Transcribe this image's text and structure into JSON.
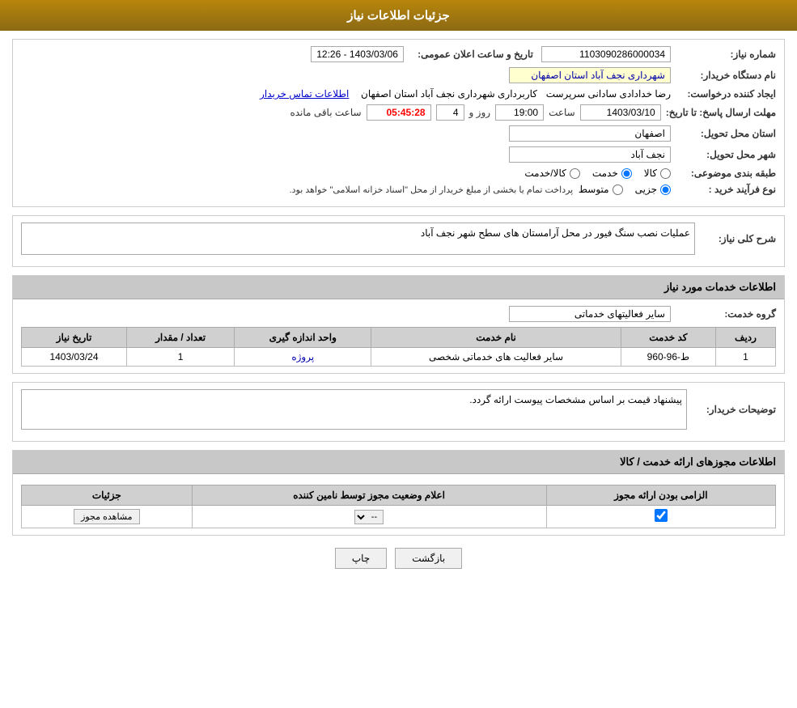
{
  "page": {
    "title": "جزئیات اطلاعات نیاز"
  },
  "header": {
    "title": "جزئیات اطلاعات نیاز"
  },
  "need_info": {
    "need_number_label": "شماره نیاز:",
    "need_number_value": "1103090286000034",
    "announcement_label": "تاریخ و ساعت اعلان عمومی:",
    "announcement_value": "1403/03/06 - 12:26",
    "buyer_org_label": "نام دستگاه خریدار:",
    "buyer_org_value": "شهرداری نجف آباد استان اصفهان",
    "creator_label": "ایجاد کننده درخواست:",
    "creator_name": "رضا خدادادی سادانی سرپرست",
    "creator_role": "کاربرداری شهرداری نجف آباد استان اصفهان",
    "creator_contact": "اطلاعات تماس خریدار",
    "deadline_label": "مهلت ارسال پاسخ: تا تاریخ:",
    "deadline_date": "1403/03/10",
    "deadline_time_label": "ساعت",
    "deadline_time": "19:00",
    "deadline_days_label": "روز و",
    "deadline_days": "4",
    "deadline_remaining_label": "ساعت باقی مانده",
    "deadline_remaining": "05:45:28",
    "province_label": "استان محل تحویل:",
    "province_value": "اصفهان",
    "city_label": "شهر محل تحویل:",
    "city_value": "نجف آباد",
    "category_label": "طبقه بندی موضوعی:",
    "category_kala": "کالا",
    "category_khedmat": "خدمت",
    "category_kala_khedmat": "کالا/خدمت",
    "category_selected": "khedmat",
    "purchase_type_label": "نوع فرآیند خرید :",
    "purchase_type_jozii": "جزیی",
    "purchase_type_motavaset": "متوسط",
    "purchase_type_note": "پرداخت تمام یا بخشی از مبلغ خریدار از محل \"اسناد خزانه اسلامی\" خواهد بود."
  },
  "general_desc": {
    "section_title": "شرح کلی نیاز:",
    "content": "عملیات نصب سنگ فیور در محل آرامستان های سطح شهر نجف آباد"
  },
  "services_info": {
    "section_title": "اطلاعات خدمات مورد نیاز",
    "service_group_label": "گروه خدمت:",
    "service_group_value": "سایر فعالیتهای خدماتی",
    "table_headers": {
      "row_num": "ردیف",
      "service_code": "کد خدمت",
      "service_name": "نام خدمت",
      "unit": "واحد اندازه گیری",
      "quantity": "تعداد / مقدار",
      "need_date": "تاریخ نیاز"
    },
    "table_rows": [
      {
        "row_num": "1",
        "service_code": "ط-96-960",
        "service_name": "سایر فعالیت های خدماتی شخصی",
        "unit": "پروژه",
        "quantity": "1",
        "need_date": "1403/03/24"
      }
    ]
  },
  "buyer_notes": {
    "section_title": "توضیحات خریدار:",
    "content": "پیشنهاد قیمت بر اساس مشخصات پیوست ارائه گردد."
  },
  "permissions": {
    "section_title": "اطلاعات مجوزهای ارائه خدمت / کالا",
    "table_headers": {
      "mandatory": "الزامی بودن ارائه مجوز",
      "provider_status": "اعلام وضعیت مجوز توسط نامین کننده",
      "details": "جزئیات"
    },
    "table_rows": [
      {
        "mandatory": true,
        "provider_status_value": "--",
        "details_label": "مشاهده مجوز"
      }
    ]
  },
  "buttons": {
    "print_label": "چاپ",
    "back_label": "بازگشت"
  }
}
